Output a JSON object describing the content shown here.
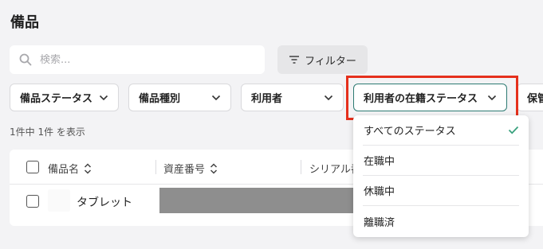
{
  "page": {
    "title": "備品"
  },
  "search": {
    "placeholder": "検索..."
  },
  "toolbar": {
    "filter_label": "フィルター"
  },
  "filters": [
    {
      "label": "備品ステータス"
    },
    {
      "label": "備品種別"
    },
    {
      "label": "利用者"
    },
    {
      "label": "利用者の在籍ステータス",
      "open": true
    },
    {
      "label": "保管"
    }
  ],
  "result_count": "1件中 1件 を表示",
  "table": {
    "columns": [
      "備品名",
      "資産番号",
      "シリアル番"
    ],
    "rows": [
      {
        "name": "タブレット"
      }
    ]
  },
  "status_menu": {
    "options": [
      {
        "label": "すべてのステータス",
        "selected": true
      },
      {
        "label": "在職中",
        "selected": false
      },
      {
        "label": "休職中",
        "selected": false
      },
      {
        "label": "離職済",
        "selected": false
      }
    ]
  },
  "colors": {
    "accent": "#2d7a72",
    "check": "#3aa17e",
    "highlight": "#e5301c",
    "background": "#f3f3f5"
  },
  "icons": {
    "search": "search-icon",
    "filter": "filter-icon",
    "chevron": "chevron-down-icon",
    "sort": "sort-icon",
    "check": "check-icon"
  }
}
